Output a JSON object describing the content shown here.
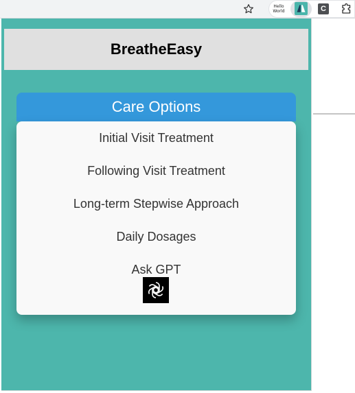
{
  "browser": {
    "extensions": [
      {
        "name": "hello-world",
        "label_line1": "Hello",
        "label_line2": "World"
      },
      {
        "name": "breatheeasy",
        "icon": "lung-icon",
        "color": "#4ab5ab"
      },
      {
        "name": "c-extension",
        "label": "C"
      }
    ]
  },
  "popup": {
    "background": "#4db6ac",
    "header": {
      "title": "BreatheEasy"
    },
    "care_button": {
      "label": "Care Options",
      "color": "#3498db"
    },
    "menu": {
      "items": [
        {
          "label": "Initial Visit Treatment"
        },
        {
          "label": "Following Visit Treatment"
        },
        {
          "label": "Long-term Stepwise Approach"
        },
        {
          "label": "Daily Dosages"
        },
        {
          "label": "Ask GPT",
          "icon": "openai-icon"
        }
      ]
    }
  }
}
